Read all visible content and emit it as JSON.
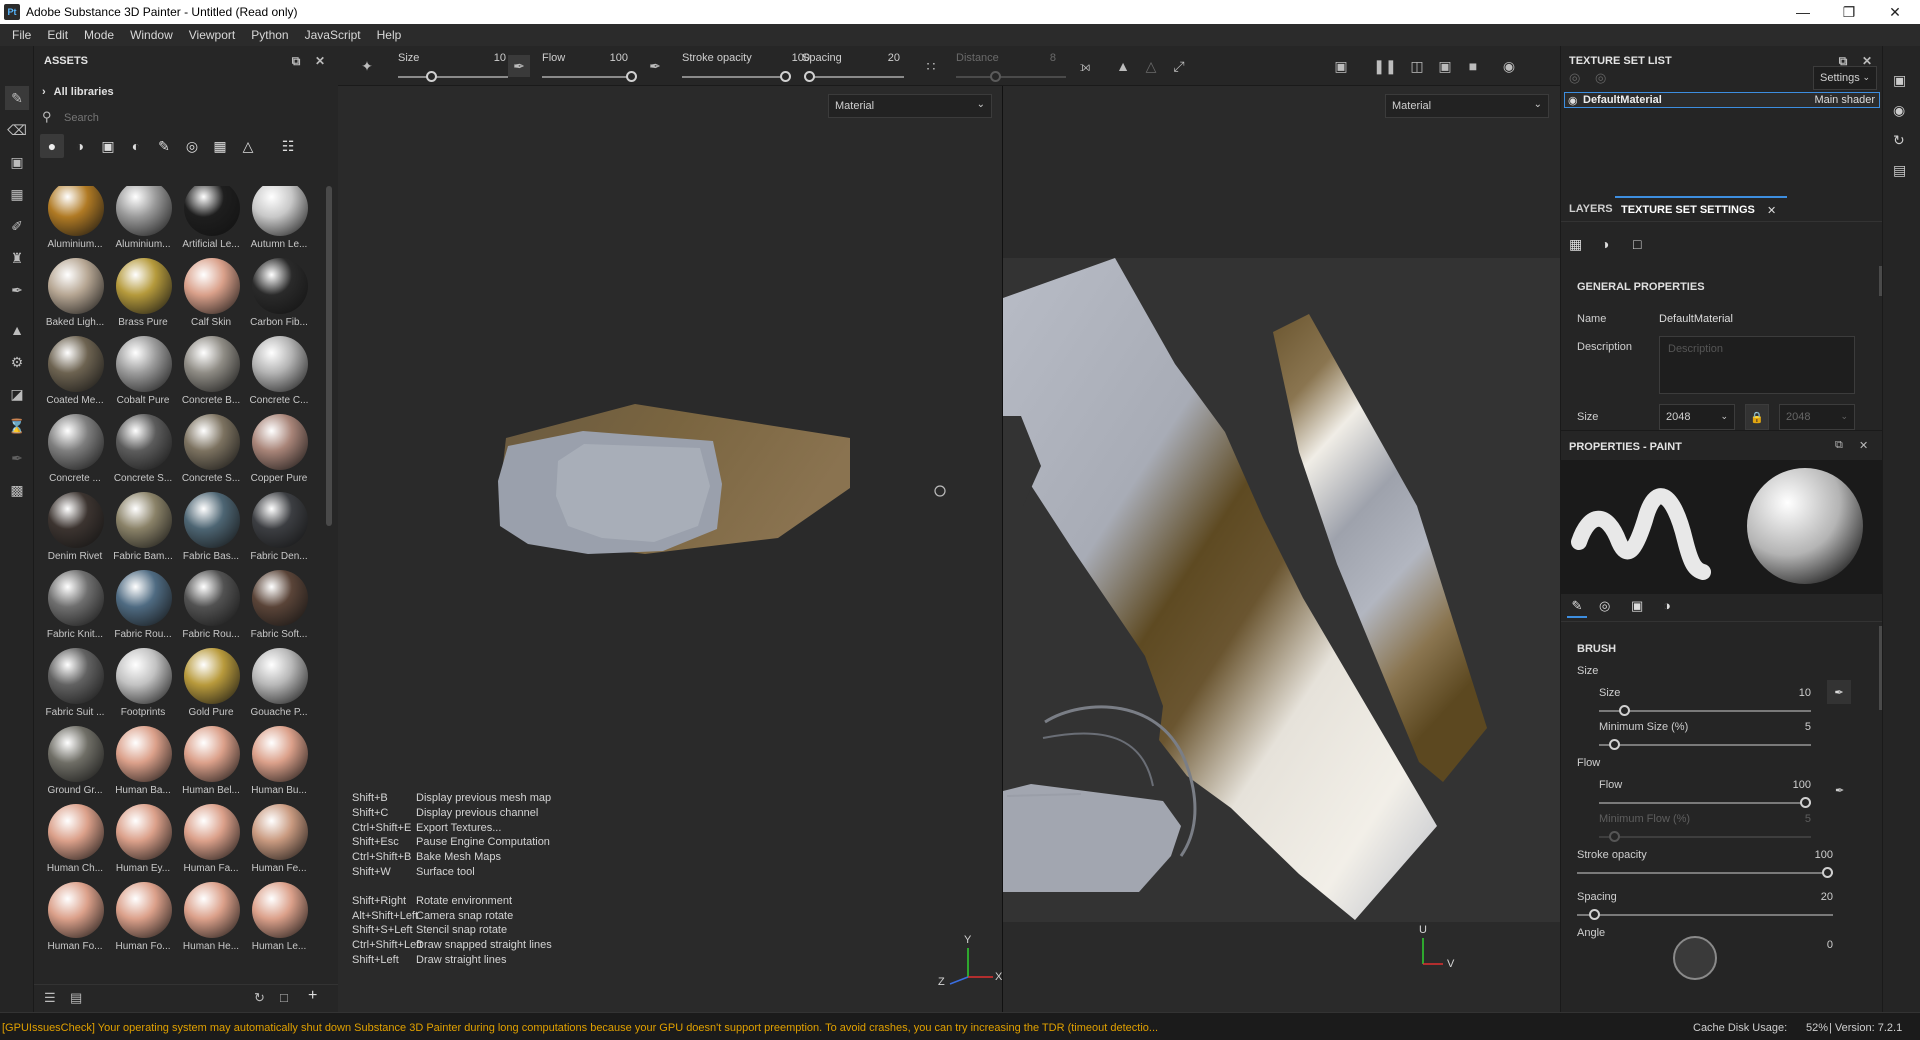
{
  "window": {
    "title": "Adobe Substance 3D Painter - Untitled (Read only)",
    "logo": "Pt"
  },
  "menu": [
    "File",
    "Edit",
    "Mode",
    "Window",
    "Viewport",
    "Python",
    "JavaScript",
    "Help"
  ],
  "assets": {
    "title": "ASSETS",
    "library": "All libraries",
    "search_placeholder": "Search",
    "items": [
      {
        "label": "Aluminium...",
        "color": "#b07a24"
      },
      {
        "label": "Aluminium...",
        "color": "#9a9a9a"
      },
      {
        "label": "Artificial Le...",
        "color": "#1e1e1e"
      },
      {
        "label": "Autumn Le...",
        "color": "#c8c8c8"
      },
      {
        "label": "Baked Ligh...",
        "color": "#b7a794"
      },
      {
        "label": "Brass Pure",
        "color": "#b59a3c"
      },
      {
        "label": "Calf Skin",
        "color": "#d9a08a"
      },
      {
        "label": "Carbon Fib...",
        "color": "#2a2a2a"
      },
      {
        "label": "Coated Me...",
        "color": "#6d6351"
      },
      {
        "label": "Cobalt Pure",
        "color": "#9c9c9c"
      },
      {
        "label": "Concrete B...",
        "color": "#8f8c85"
      },
      {
        "label": "Concrete C...",
        "color": "#b4b4b4"
      },
      {
        "label": "Concrete ...",
        "color": "#7e7e7e"
      },
      {
        "label": "Concrete S...",
        "color": "#5c5c5c"
      },
      {
        "label": "Concrete S...",
        "color": "#7c7260"
      },
      {
        "label": "Copper Pure",
        "color": "#a88478"
      },
      {
        "label": "Denim Rivet",
        "color": "#3c3430"
      },
      {
        "label": "Fabric Bam...",
        "color": "#8a8268"
      },
      {
        "label": "Fabric Bas...",
        "color": "#4d6573"
      },
      {
        "label": "Fabric Den...",
        "color": "#3c3e42"
      },
      {
        "label": "Fabric Knit...",
        "color": "#6f6f6f"
      },
      {
        "label": "Fabric Rou...",
        "color": "#4f6b82"
      },
      {
        "label": "Fabric Rou...",
        "color": "#525252"
      },
      {
        "label": "Fabric Soft...",
        "color": "#5a4438"
      },
      {
        "label": "Fabric Suit ...",
        "color": "#626262"
      },
      {
        "label": "Footprints",
        "color": "#c2c2c2"
      },
      {
        "label": "Gold Pure",
        "color": "#b89a3c"
      },
      {
        "label": "Gouache P...",
        "color": "#b8b8b8"
      },
      {
        "label": "Ground Gr...",
        "color": "#6f6e66"
      },
      {
        "label": "Human Ba...",
        "color": "#dba08a"
      },
      {
        "label": "Human Bel...",
        "color": "#dba08a"
      },
      {
        "label": "Human Bu...",
        "color": "#dba08a"
      },
      {
        "label": "Human Ch...",
        "color": "#dba08a"
      },
      {
        "label": "Human Ey...",
        "color": "#dba08a"
      },
      {
        "label": "Human Fa...",
        "color": "#dba08a"
      },
      {
        "label": "Human Fe...",
        "color": "#c99a80"
      },
      {
        "label": "Human Fo...",
        "color": "#dba08a"
      },
      {
        "label": "Human Fo...",
        "color": "#dba08a"
      },
      {
        "label": "Human He...",
        "color": "#dba08a"
      },
      {
        "label": "Human Le...",
        "color": "#dba08a"
      }
    ]
  },
  "toolbar": {
    "size_label": "Size",
    "size_value": "10",
    "flow_label": "Flow",
    "flow_value": "100",
    "stroke_label": "Stroke opacity",
    "stroke_value": "100",
    "spacing_label": "Spacing",
    "spacing_value": "20",
    "distance_label": "Distance",
    "distance_value": "8"
  },
  "viewport3d": {
    "channel": "Material",
    "axis_x": "X",
    "axis_y": "Y",
    "axis_z": "Z"
  },
  "viewport2d": {
    "channel": "Material",
    "axis_u": "U",
    "axis_v": "V"
  },
  "shortcuts": [
    {
      "key": "Shift+B",
      "desc": "Display previous mesh map"
    },
    {
      "key": "Shift+C",
      "desc": "Display previous channel"
    },
    {
      "key": "Ctrl+Shift+E",
      "desc": "Export Textures..."
    },
    {
      "key": "Shift+Esc",
      "desc": "Pause Engine Computation"
    },
    {
      "key": "Ctrl+Shift+B",
      "desc": "Bake Mesh Maps"
    },
    {
      "key": "Shift+W",
      "desc": "Surface tool"
    },
    {
      "key": "Shift+Right",
      "desc": "Rotate environment"
    },
    {
      "key": "Alt+Shift+Left",
      "desc": "Camera snap rotate"
    },
    {
      "key": "Shift+S+Left",
      "desc": "Stencil snap rotate"
    },
    {
      "key": "Ctrl+Shift+Left",
      "desc": "Draw snapped straight lines"
    },
    {
      "key": "Shift+Left",
      "desc": "Draw straight lines"
    }
  ],
  "texture_set_list": {
    "title": "TEXTURE SET LIST",
    "settings": "Settings",
    "item": "DefaultMaterial",
    "shader": "Main shader"
  },
  "tabs": {
    "layers": "LAYERS",
    "tss": "TEXTURE SET SETTINGS"
  },
  "general": {
    "title": "GENERAL PROPERTIES",
    "name_label": "Name",
    "name_value": "DefaultMaterial",
    "desc_label": "Description",
    "desc_placeholder": "Description",
    "size_label": "Size",
    "size_value": "2048",
    "size_value2": "2048"
  },
  "props_paint": {
    "title": "PROPERTIES - PAINT"
  },
  "brush": {
    "title": "BRUSH",
    "size_group": "Size",
    "size_label": "Size",
    "size_value": "10",
    "size_level": 0.1,
    "min_size_label": "Minimum Size (%)",
    "min_size_value": "5",
    "min_size_level": 0.05,
    "flow_group": "Flow",
    "flow_label": "Flow",
    "flow_value": "100",
    "flow_level": 1.0,
    "min_flow_label": "Minimum Flow (%)",
    "min_flow_value": "5",
    "min_flow_level": 0.05,
    "stroke_label": "Stroke opacity",
    "stroke_value": "100",
    "stroke_level": 1.0,
    "spacing_label": "Spacing",
    "spacing_value": "20",
    "spacing_level": 0.05,
    "angle_label": "Angle",
    "angle_value": "0"
  },
  "status": {
    "message": "[GPUIssuesCheck] Your operating system may automatically shut down Substance 3D Painter during long computations because your GPU doesn't support preemption. To avoid crashes, you can try increasing the TDR (timeout detectio...",
    "cache_label": "Cache Disk Usage:",
    "cache_value": "52%",
    "version": "| Version: 7.2.1"
  },
  "colors": {
    "accent": "#3d8ee0",
    "warning": "#e0a000"
  }
}
